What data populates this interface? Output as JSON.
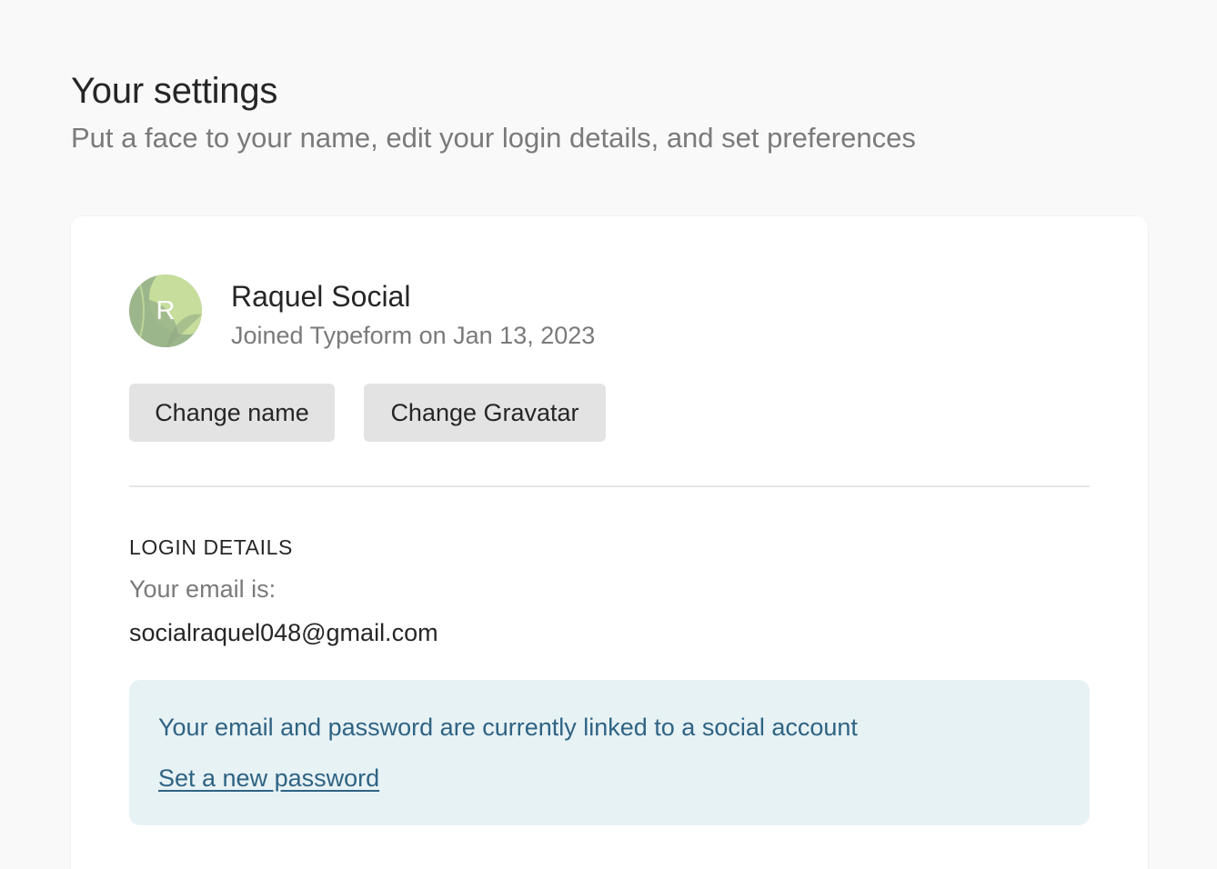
{
  "header": {
    "title": "Your settings",
    "subtitle": "Put a face to your name, edit your login details, and set preferences"
  },
  "profile": {
    "avatar_initial": "R",
    "avatar_colors": [
      "#9cb68c",
      "#c6dd9c"
    ],
    "name": "Raquel Social",
    "joined": "Joined Typeform on Jan 13, 2023"
  },
  "actions": {
    "change_name_label": "Change name",
    "change_gravatar_label": "Change Gravatar"
  },
  "login_details": {
    "heading": "LOGIN DETAILS",
    "email_label": "Your email is:",
    "email": "socialraquel048@gmail.com"
  },
  "social_notice": {
    "message": "Your email and password are currently linked to a social account",
    "link_label": "Set a new password",
    "background_color": "#e7f2f5",
    "text_color": "#2f6383"
  }
}
